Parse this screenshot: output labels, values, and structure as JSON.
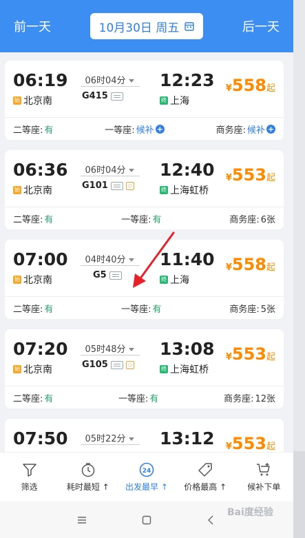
{
  "header": {
    "prev_day": "前一天",
    "date": "10月30日 周五",
    "next_day": "后一天",
    "bg_color": "#3d8ef2"
  },
  "trains": [
    {
      "dep_time": "06:19",
      "duration": "06时04分",
      "train_no": "G415",
      "arr_time": "12:23",
      "start_badge": "始",
      "dep_station": "北京南",
      "end_badge": "终",
      "arr_station": "上海",
      "price_symbol": "¥",
      "price": "558",
      "price_suffix": "起",
      "seats": [
        {
          "label": "二等座:",
          "value": "有"
        },
        {
          "label": "一等座:",
          "value": "候补"
        },
        {
          "label": "商务座:",
          "value": "候补"
        }
      ]
    },
    {
      "dep_time": "06:36",
      "duration": "06时04分",
      "train_no": "G101",
      "arr_time": "12:40",
      "start_badge": "始",
      "dep_station": "北京南",
      "end_badge": "终",
      "arr_station": "上海虹桥",
      "price_symbol": "¥",
      "price": "553",
      "price_suffix": "起",
      "seats": [
        {
          "label": "二等座:",
          "value": "有"
        },
        {
          "label": "一等座:",
          "value": "有"
        },
        {
          "label": "商务座:",
          "value": "6张"
        }
      ]
    },
    {
      "dep_time": "07:00",
      "duration": "04时40分",
      "train_no": "G5",
      "arr_time": "11:40",
      "start_badge": "始",
      "dep_station": "北京南",
      "end_badge": "终",
      "arr_station": "上海",
      "price_symbol": "¥",
      "price": "558",
      "price_suffix": "起",
      "seats": [
        {
          "label": "二等座:",
          "value": "有"
        },
        {
          "label": "一等座:",
          "value": "有"
        },
        {
          "label": "商务座:",
          "value": "5张"
        }
      ]
    },
    {
      "dep_time": "07:20",
      "duration": "05时48分",
      "train_no": "G105",
      "arr_time": "13:08",
      "start_badge": "始",
      "dep_station": "北京南",
      "end_badge": "终",
      "arr_station": "上海虹桥",
      "price_symbol": "¥",
      "price": "553",
      "price_suffix": "起",
      "seats": [
        {
          "label": "二等座:",
          "value": "有"
        },
        {
          "label": "一等座:",
          "value": "有"
        },
        {
          "label": "商务座:",
          "value": "12张"
        }
      ]
    },
    {
      "dep_time": "07:50",
      "duration": "05时22分",
      "train_no": "",
      "arr_time": "13:12",
      "price_symbol": "¥",
      "price": "553",
      "price_suffix": "起"
    }
  ],
  "filters": [
    {
      "label": "筛选",
      "icon": "filter-icon"
    },
    {
      "label": "耗时最短",
      "icon": "clock-icon"
    },
    {
      "label": "出发最早",
      "icon": "24-icon"
    },
    {
      "label": "价格最高",
      "icon": "price-tag-icon"
    },
    {
      "label": "候补下单",
      "icon": "cart-plus-icon"
    }
  ],
  "watermark": "Bai度经验",
  "colors": {
    "price": "#ff8a00",
    "available": "#2aa36b",
    "accent": "#2f7fe8",
    "arrow": "#e8202a"
  }
}
